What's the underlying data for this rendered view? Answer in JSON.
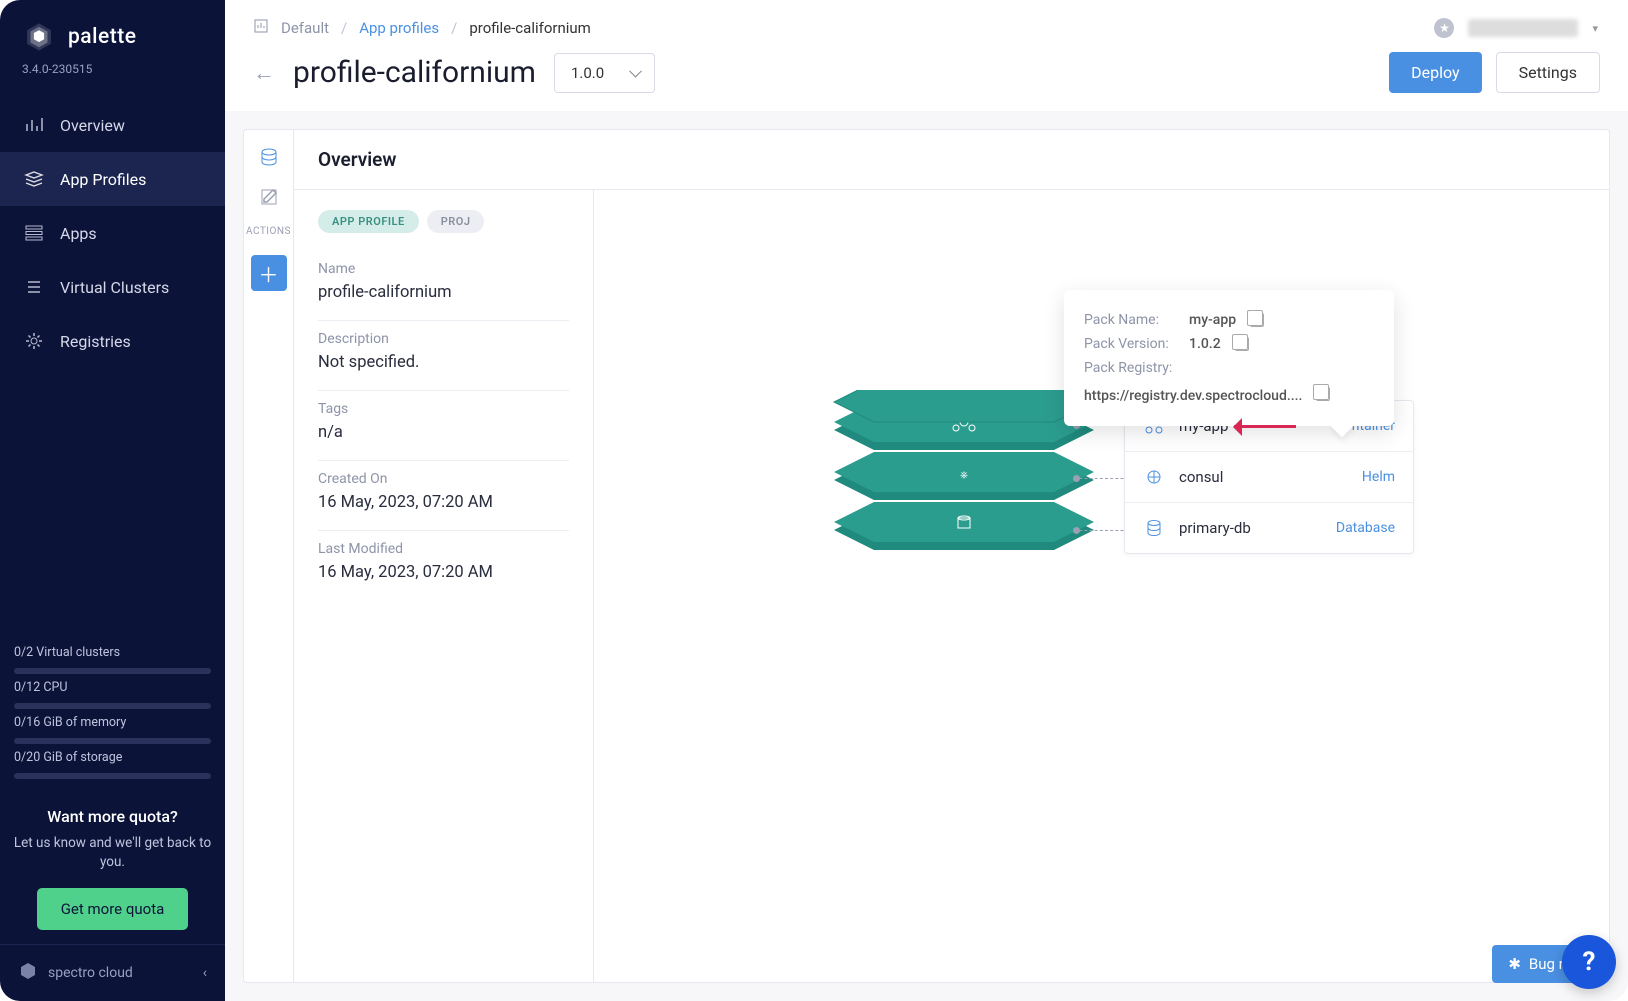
{
  "brand": {
    "name": "palette",
    "version": "3.4.0-230515"
  },
  "nav": {
    "overview": "Overview",
    "appProfiles": "App Profiles",
    "apps": "Apps",
    "virtualClusters": "Virtual Clusters",
    "registries": "Registries"
  },
  "quota": {
    "items": {
      "vc": "0/2 Virtual clusters",
      "cpu": "0/12 CPU",
      "mem": "0/16 GiB of memory",
      "storage": "0/20 GiB of storage"
    },
    "title": "Want more quota?",
    "sub": "Let us know and we'll get back to you.",
    "button": "Get more quota"
  },
  "footer": {
    "label": "spectro cloud"
  },
  "breadcrumb": {
    "root": "Default",
    "mid": "App profiles",
    "current": "profile-californium"
  },
  "page": {
    "title": "profile-californium",
    "version": "1.0.0",
    "deploy": "Deploy",
    "settings": "Settings"
  },
  "railActionsLabel": "ACTIONS",
  "panel": {
    "title": "Overview",
    "pills": {
      "appProfile": "APP PROFILE",
      "proj": "PROJ"
    },
    "fields": {
      "nameLabel": "Name",
      "nameValue": "profile-californium",
      "descLabel": "Description",
      "descValue": "Not specified.",
      "tagsLabel": "Tags",
      "tagsValue": "n/a",
      "createdLabel": "Created On",
      "createdValue": "16 May, 2023, 07:20 AM",
      "modifiedLabel": "Last Modified",
      "modifiedValue": "16 May, 2023, 07:20 AM"
    }
  },
  "layers": {
    "myapp": {
      "name": "my-app",
      "type": "Container"
    },
    "consul": {
      "name": "consul",
      "type": "Helm"
    },
    "primarydb": {
      "name": "primary-db",
      "type": "Database"
    }
  },
  "tooltip": {
    "packNameLabel": "Pack Name:",
    "packNameValue": "my-app",
    "packVersionLabel": "Pack Version:",
    "packVersionValue": "1.0.2",
    "packRegistryLabel": "Pack Registry:",
    "packRegistryValue": "https://registry.dev.spectrocloud...."
  },
  "bugReport": "Bug rep",
  "help": "?"
}
